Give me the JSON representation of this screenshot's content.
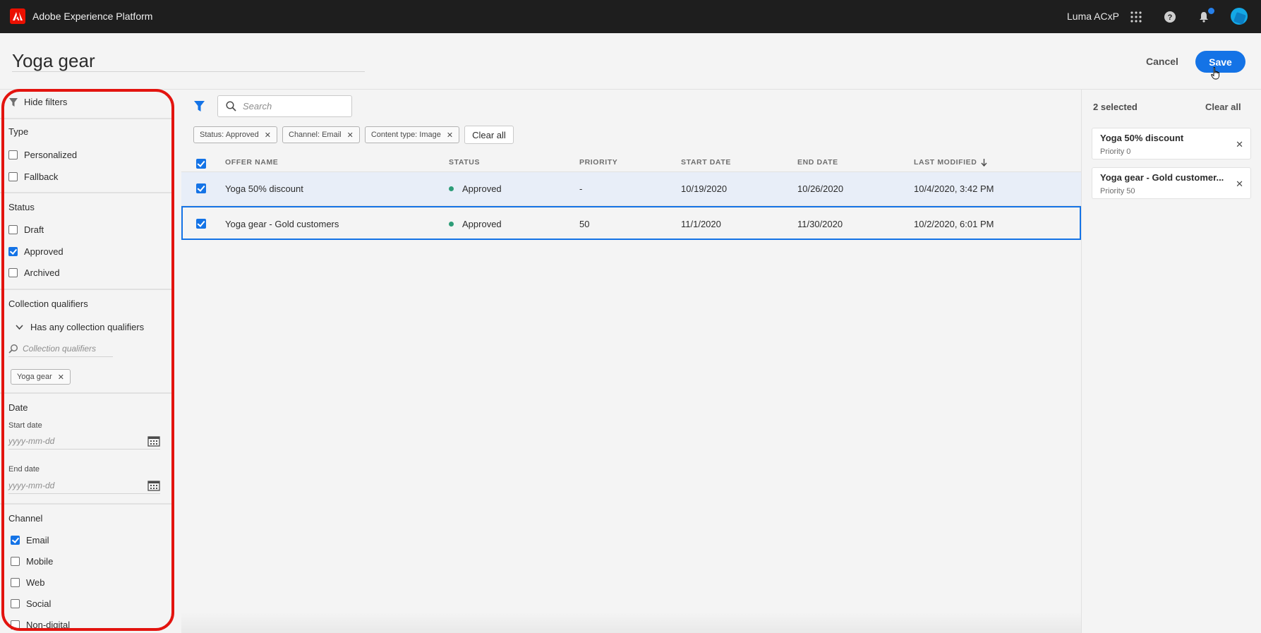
{
  "topbar": {
    "app_title": "Adobe Experience Platform",
    "org_name": "Luma ACxP",
    "icons": [
      "adobe-logo-icon",
      "apps-grid-icon",
      "help-icon",
      "bell-icon",
      "avatar"
    ]
  },
  "header": {
    "title": "Yoga gear",
    "cancel_label": "Cancel",
    "save_label": "Save"
  },
  "filters": {
    "hide_label": "Hide filters",
    "type": {
      "title": "Type",
      "options": [
        {
          "label": "Personalized",
          "checked": false
        },
        {
          "label": "Fallback",
          "checked": false
        }
      ]
    },
    "status": {
      "title": "Status",
      "options": [
        {
          "label": "Draft",
          "checked": false
        },
        {
          "label": "Approved",
          "checked": true
        },
        {
          "label": "Archived",
          "checked": false
        }
      ]
    },
    "collection": {
      "title": "Collection qualifiers",
      "mode": "Has any collection qualifiers",
      "search_placeholder": "Collection qualifiers",
      "tag": "Yoga gear"
    },
    "date": {
      "title": "Date",
      "start_label": "Start date",
      "start_placeholder": "yyyy-mm-dd",
      "end_label": "End date",
      "end_placeholder": "yyyy-mm-dd"
    },
    "channel": {
      "title": "Channel",
      "options": [
        {
          "label": "Email",
          "checked": true
        },
        {
          "label": "Mobile",
          "checked": false
        },
        {
          "label": "Web",
          "checked": false
        },
        {
          "label": "Social",
          "checked": false
        },
        {
          "label": "Non-digital",
          "checked": false
        }
      ]
    }
  },
  "main": {
    "search_placeholder": "Search",
    "chips": [
      "Status: Approved",
      "Channel: Email",
      "Content type: Image"
    ],
    "clear_all": "Clear all",
    "columns": [
      "OFFER NAME",
      "STATUS",
      "PRIORITY",
      "START DATE",
      "END DATE",
      "LAST MODIFIED"
    ],
    "rows": [
      {
        "name": "Yoga 50% discount",
        "status": "Approved",
        "priority": "-",
        "start": "10/19/2020",
        "end": "10/26/2020",
        "modified": "10/4/2020, 3:42 PM"
      },
      {
        "name": "Yoga gear - Gold customers",
        "status": "Approved",
        "priority": "50",
        "start": "11/1/2020",
        "end": "11/30/2020",
        "modified": "10/2/2020, 6:01 PM"
      }
    ]
  },
  "selection": {
    "count_label": "2 selected",
    "clear_all": "Clear all",
    "items": [
      {
        "name": "Yoga 50% discount",
        "priority": "Priority 0"
      },
      {
        "name": "Yoga gear - Gold customer...",
        "priority": "Priority 50"
      }
    ]
  },
  "colors": {
    "accent": "#1473e6",
    "topbar": "#1e1e1e",
    "highlight_outline": "#e3140f",
    "status_approved": "#2d9d78",
    "adobe_red": "#eb1000"
  }
}
